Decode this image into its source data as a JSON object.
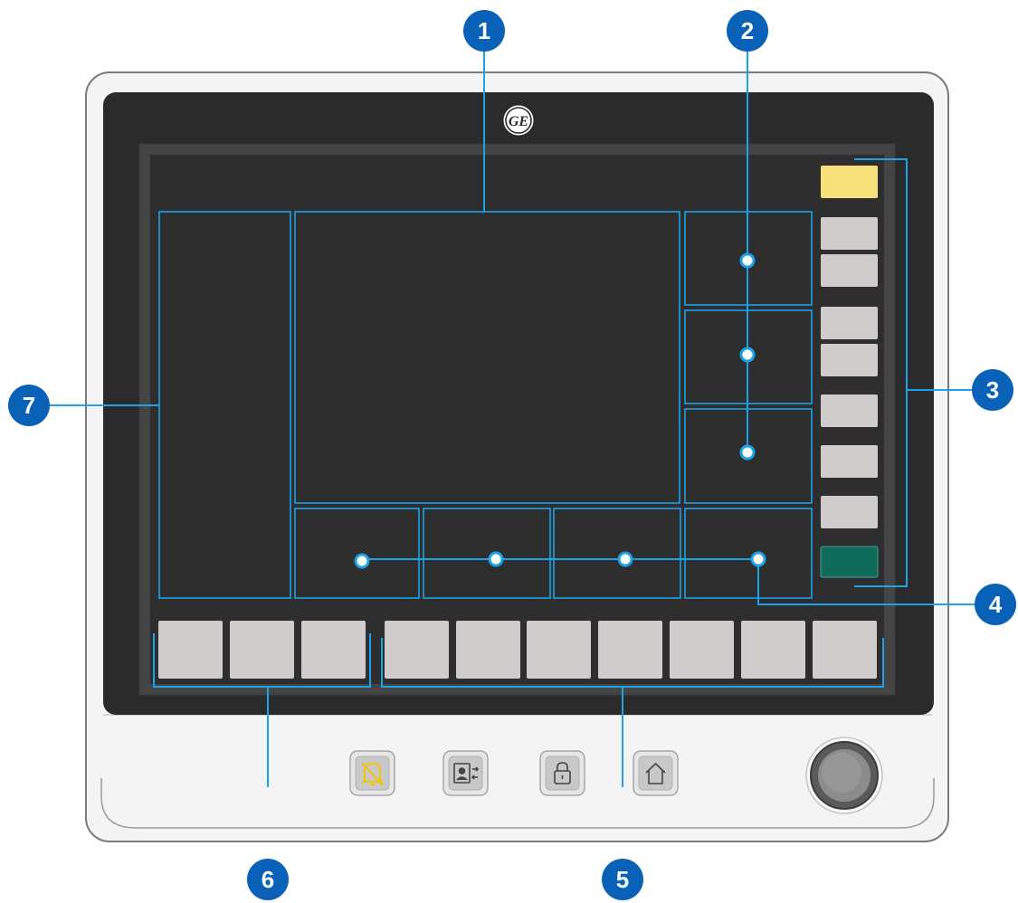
{
  "brand": {
    "logo_text": "GE"
  },
  "colors": {
    "bezel_outer": "#f4f4f4",
    "bezel_edge": "#7a7a7a",
    "panel": "#2b2b2b",
    "screen": "#2e2e2e",
    "region_outline": "#1aa3e8",
    "callout_fill": "#0a62b8",
    "key_gray": "#cfcccb",
    "key_yellow": "#f8e07a",
    "key_green": "#0f6b5a",
    "alarm_icon": "#f2c500"
  },
  "callouts": [
    {
      "label": "1",
      "meaning": "waveform area"
    },
    {
      "label": "2",
      "meaning": "measured value windows"
    },
    {
      "label": "3",
      "meaning": "right-side quick keys"
    },
    {
      "label": "4",
      "meaning": "bottom-right value window"
    },
    {
      "label": "5",
      "meaning": "bottom quick keys"
    },
    {
      "label": "6",
      "meaning": "bottom-left menu keys"
    },
    {
      "label": "7",
      "meaning": "left information area"
    }
  ],
  "hardware_keys": [
    {
      "icon": "alarm-silence-icon"
    },
    {
      "icon": "user-switch-icon"
    },
    {
      "icon": "lock-icon"
    },
    {
      "icon": "home-icon"
    }
  ],
  "knob": {
    "icon": "control-knob"
  }
}
